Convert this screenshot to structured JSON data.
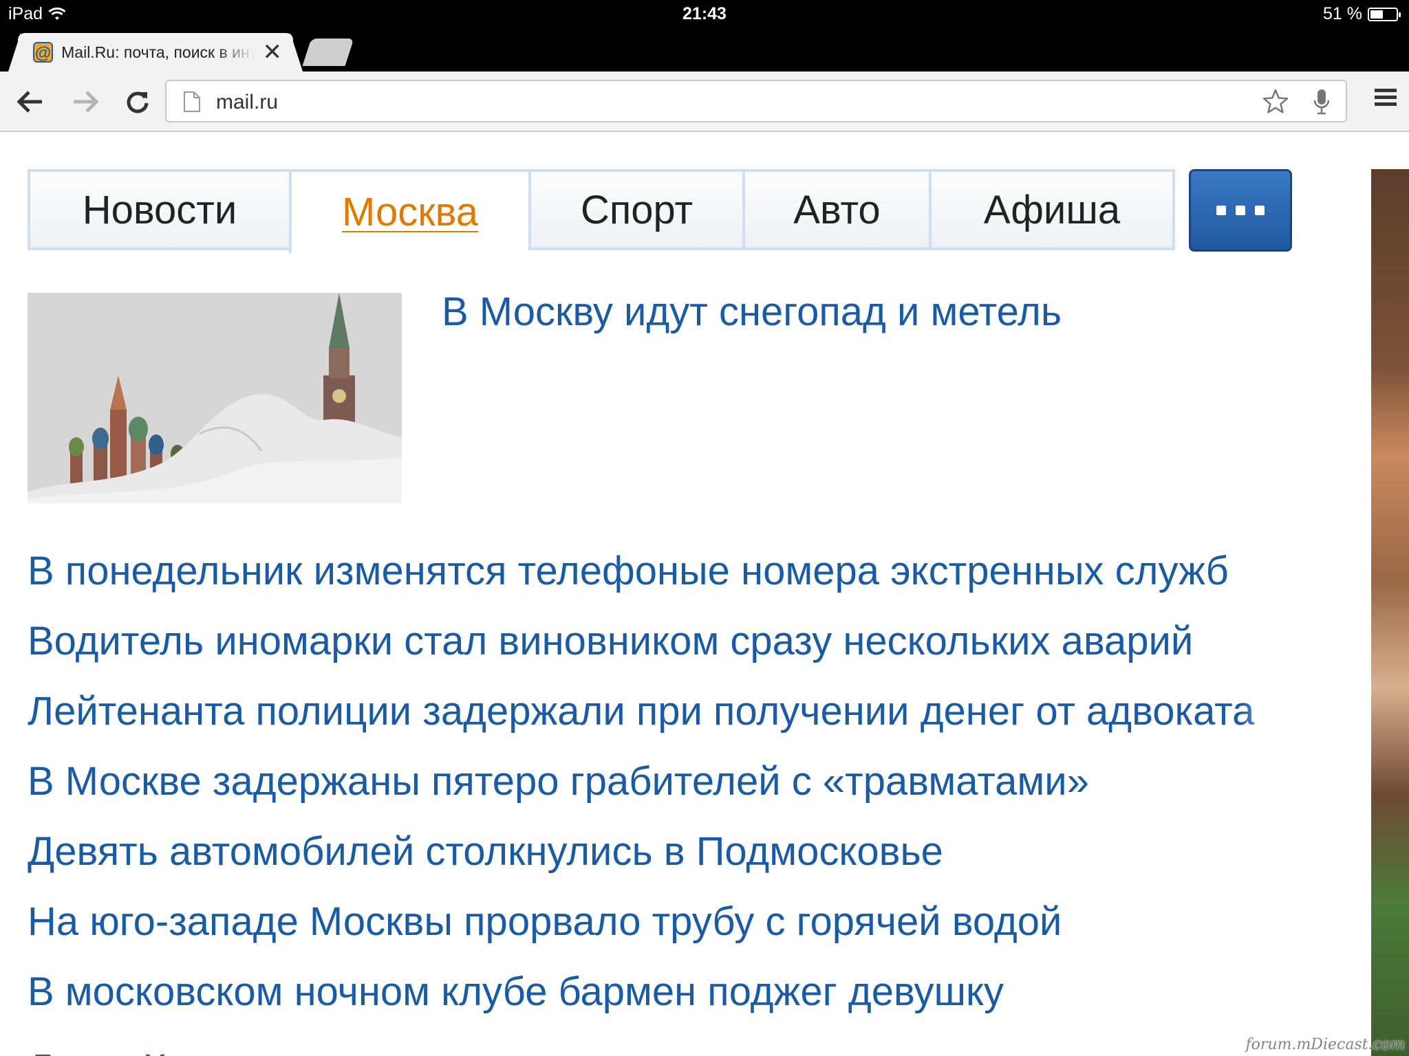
{
  "status_bar": {
    "device": "iPad",
    "time": "21:43",
    "battery": "51 %",
    "battery_level": 0.51
  },
  "browser": {
    "active_tab_title": "Mail.Ru: почта, поиск в интернете",
    "favicon": "@",
    "url": "mail.ru",
    "icons": [
      "back-arrow-icon",
      "forward-arrow-icon",
      "reload-icon",
      "page-icon",
      "star-icon",
      "mic-icon",
      "menu-icon",
      "close-icon",
      "wifi-icon"
    ]
  },
  "news": {
    "tabs": [
      {
        "label": "Новости"
      },
      {
        "label": "Москва"
      },
      {
        "label": "Спорт"
      },
      {
        "label": "Авто"
      },
      {
        "label": "Афиша"
      }
    ],
    "active_tab": "Москва",
    "lead_title": "В Москву идут снегопад и метель",
    "headlines": [
      "В понедельник изменятся телефоные номера экстренных служб",
      "Водитель иномарки стал виновником сразу нескольких аварий",
      "Лейтенанта полиции задержали при получении денег от адвоката",
      "В Москве задержаны пятеро грабителей с «травматами»",
      "Девять автомобилей столкнулись в Подмосковье",
      "На юго-западе Москвы прорвало трубу с горячей водой",
      "В московском ночном клубе бармен поджег девушку"
    ],
    "partial_prefix": "Леди.",
    "partial_link": "Как сделать сережки своими руками"
  },
  "watermark": "forum.mDiecast.com",
  "colors": {
    "link_blue": "#1a5ba6",
    "active_orange": "#e07a00",
    "button_blue": "#2a66b0"
  }
}
